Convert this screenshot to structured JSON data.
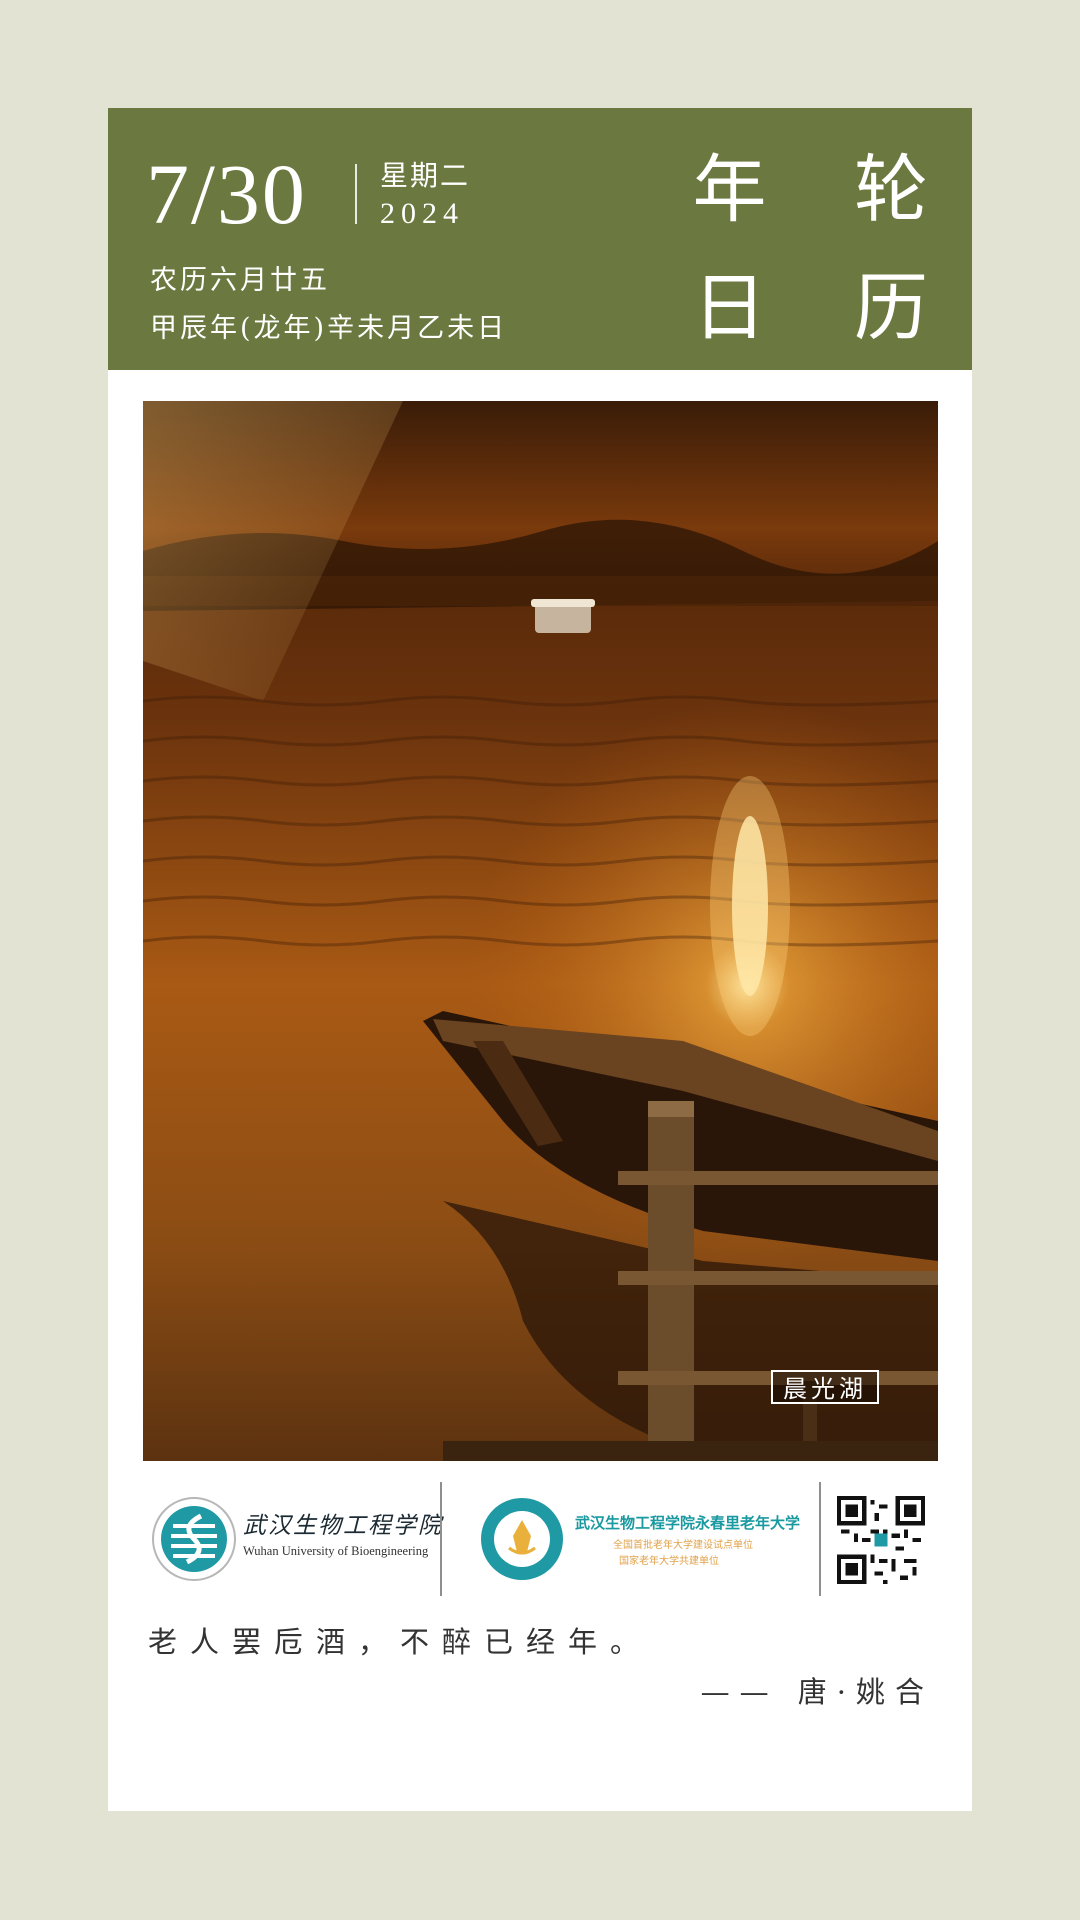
{
  "header": {
    "date": "7/30",
    "weekday": "星期二",
    "year": "2024",
    "lunar_date": "农历六月廿五",
    "ganzhi": "甲辰年(龙年)辛未月乙未日",
    "brand_line1": "年 轮",
    "brand_line2": "日 历"
  },
  "photo": {
    "caption": "晨光湖"
  },
  "logos": {
    "university_cn": "武汉生物工程学院",
    "university_en": "Wuhan University of Bioengineering",
    "senior_college_cn": "武汉生物工程学院永春里老年大学",
    "senior_college_sub1": "全国首批老年大学建设试点单位",
    "senior_college_sub2": "国家老年大学共建单位"
  },
  "quote": {
    "text": "老人罢卮酒，不醉已经年。",
    "author": "—— 唐·姚合"
  },
  "colors": {
    "background": "#e2e3d2",
    "header": "#6b7940",
    "card": "#ffffff"
  }
}
